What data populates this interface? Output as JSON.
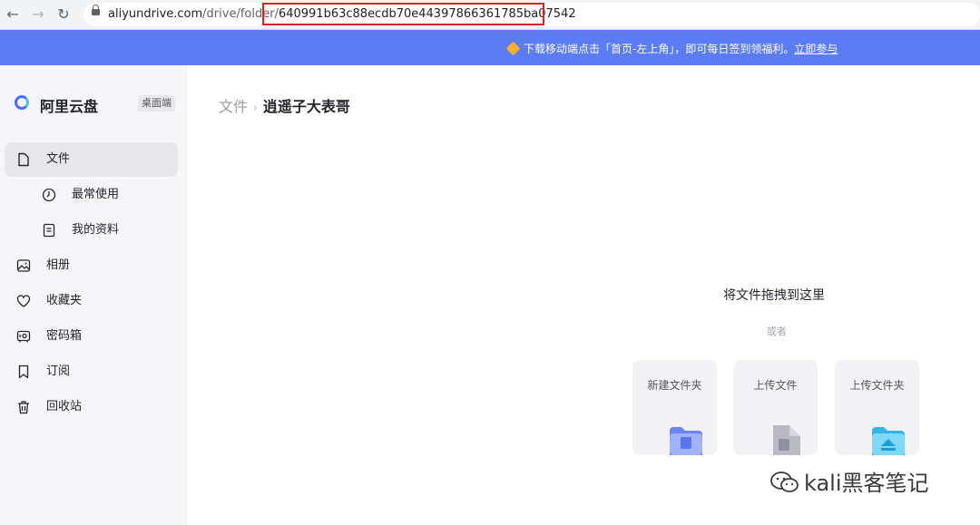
{
  "browser": {
    "back_icon": "arrow-left-icon",
    "forward_icon": "arrow-right-icon",
    "reload_icon": "reload-icon",
    "url_host": "aliyundrive.com",
    "url_path": "/drive/folder/",
    "url_id": "640991b63c88ecdb70e44397866361785ba07542"
  },
  "banner": {
    "text": "下载移动端点击「首页-左上角」，即可每日签到领福利。",
    "link": "立即参与"
  },
  "sidebar": {
    "logo": "阿里云盘",
    "tag": "桌面端",
    "items": [
      {
        "label": "文件",
        "icon": "file-icon"
      },
      {
        "label": "最常使用",
        "icon": "clock-icon"
      },
      {
        "label": "我的资料",
        "icon": "document-icon"
      },
      {
        "label": "相册",
        "icon": "photo-icon"
      },
      {
        "label": "收藏夹",
        "icon": "heart-icon"
      },
      {
        "label": "密码箱",
        "icon": "safe-icon"
      },
      {
        "label": "订阅",
        "icon": "bookmark-icon"
      },
      {
        "label": "回收站",
        "icon": "trash-icon"
      }
    ]
  },
  "breadcrumb": {
    "root": "文件",
    "current": "逍遥子大表哥"
  },
  "empty": {
    "title": "将文件拖拽到这里",
    "or": "或者",
    "actions": [
      "新建文件夹",
      "上传文件",
      "上传文件夹"
    ]
  },
  "watermark": "kali黑客笔记",
  "colors": {
    "banner": "#5b7cf5",
    "accent": "#4a6cf7",
    "highlight_box": "#e02020"
  }
}
